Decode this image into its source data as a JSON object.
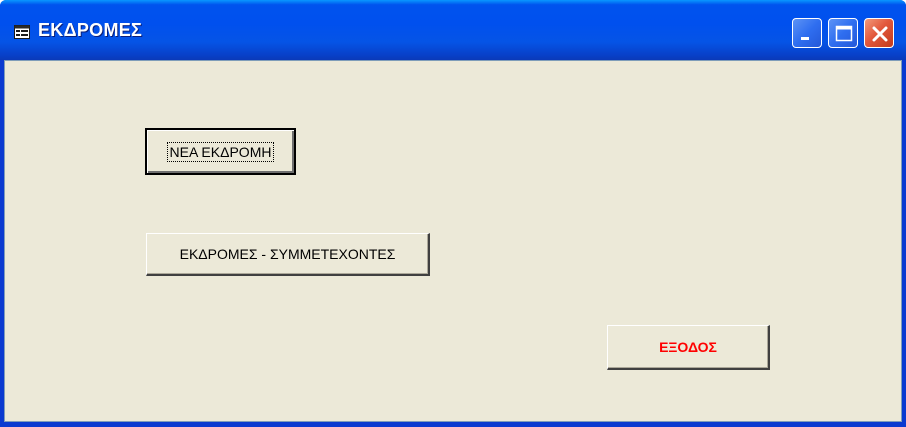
{
  "window": {
    "title": "ΕΚΔΡΟΜΕΣ",
    "controls": {
      "minimize_icon": "minimize-icon",
      "maximize_icon": "maximize-icon",
      "close_icon": "close-icon"
    }
  },
  "form": {
    "new_trip_label": "ΝΕΑ ΕΚΔΡΟΜΗ",
    "trips_participants_label": "ΕΚΔΡΟΜΕΣ - ΣΥΜΜΕΤΕΧΟΝΤΕΣ",
    "exit_label": "ΕΞΟΔΟΣ"
  },
  "colors": {
    "titlebar": "#0053ee",
    "client_bg": "#ece9d8",
    "exit_text": "#ff0000",
    "close_button": "#e2583c"
  }
}
